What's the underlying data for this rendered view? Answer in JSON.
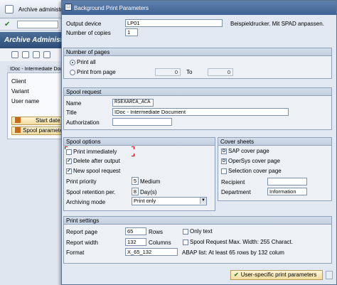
{
  "background_window": {
    "title": "Archive administration",
    "header_title": "Archive Administration",
    "form_header": "IDoc - Intermediate Document",
    "labels": [
      "Client",
      "Variant",
      "User name"
    ],
    "buttons": [
      "Start date",
      "Spool parameters"
    ]
  },
  "dialog": {
    "title": "Background Print Parameters",
    "output_device": {
      "label": "Output device",
      "value": "LP01",
      "note": "Beispieldrucker. Mit SPAD anpassen."
    },
    "copies": {
      "label": "Number of copies",
      "value": "1"
    },
    "pages": {
      "group_title": "Number of pages",
      "print_all_label": "Print all",
      "print_from_label": "Print from page",
      "from_value": "0",
      "to_label": "To",
      "to_value": "0"
    },
    "spool_request": {
      "group_title": "Spool request",
      "name_label": "Name",
      "name_value": "RSEXARCA_ACA",
      "title_label": "Title",
      "title_value": "IDoc - Intermediate Document",
      "auth_label": "Authorization",
      "auth_value": ""
    },
    "spool_options": {
      "group_title": "Spool options",
      "print_immediately_label": "Print immediately",
      "delete_after_output_label": "Delete after output",
      "new_spool_request_label": "New spool request",
      "priority_label": "Print priority",
      "priority_value": "5",
      "priority_text": "Medium",
      "retention_label": "Spool retention per.",
      "retention_value": "8",
      "retention_text": "Day(s)",
      "archiving_label": "Archiving mode",
      "archiving_value": "Print only"
    },
    "cover_sheets": {
      "group_title": "Cover sheets",
      "sap_cover_label": "SAP cover page",
      "opersys_cover_label": "OperSys cover page",
      "selection_cover_label": "Selection cover page",
      "recipient_label": "Recipient",
      "recipient_value": "",
      "department_label": "Department",
      "department_value": "Information"
    },
    "print_settings": {
      "group_title": "Print settings",
      "report_page_label": "Report page",
      "report_page_value": "65",
      "rows_label": "Rows",
      "only_text_label": "Only text",
      "report_width_label": "Report width",
      "report_width_value": "132",
      "columns_label": "Columns",
      "spool_max_label": "Spool Request Max. Width: 255 Charact.",
      "format_label": "Format",
      "format_value": "X_65_132",
      "abap_note": "ABAP list: At least 65 rows by 132 colum"
    },
    "footer_button": "User-specific print parameters"
  }
}
